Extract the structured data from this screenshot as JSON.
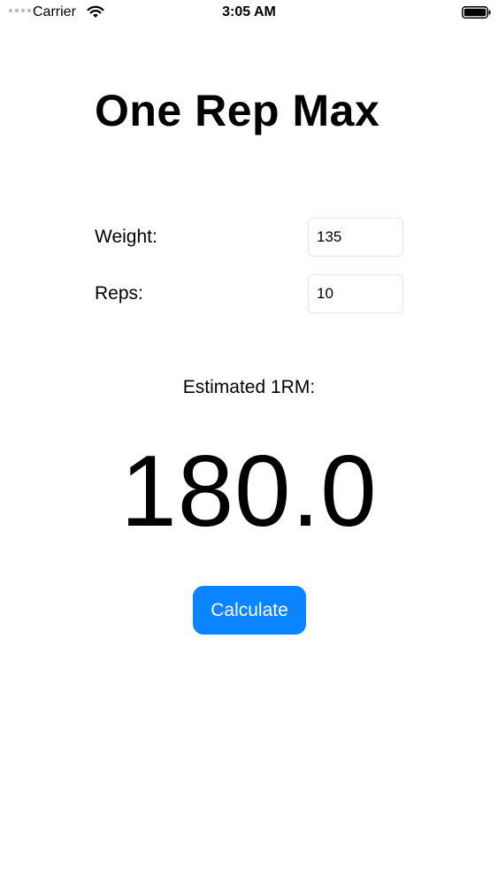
{
  "status_bar": {
    "carrier": "Carrier",
    "time": "3:05 AM",
    "icons": [
      "signal-dots-icon",
      "wifi-icon",
      "battery-icon"
    ]
  },
  "title": "One Rep Max",
  "form": {
    "weight_label": "Weight:",
    "weight_value": "135",
    "reps_label": "Reps:",
    "reps_value": "10"
  },
  "result": {
    "label": "Estimated 1RM:",
    "value": "180.0"
  },
  "calculate_button": {
    "label": "Calculate",
    "color": "#0a84ff"
  }
}
